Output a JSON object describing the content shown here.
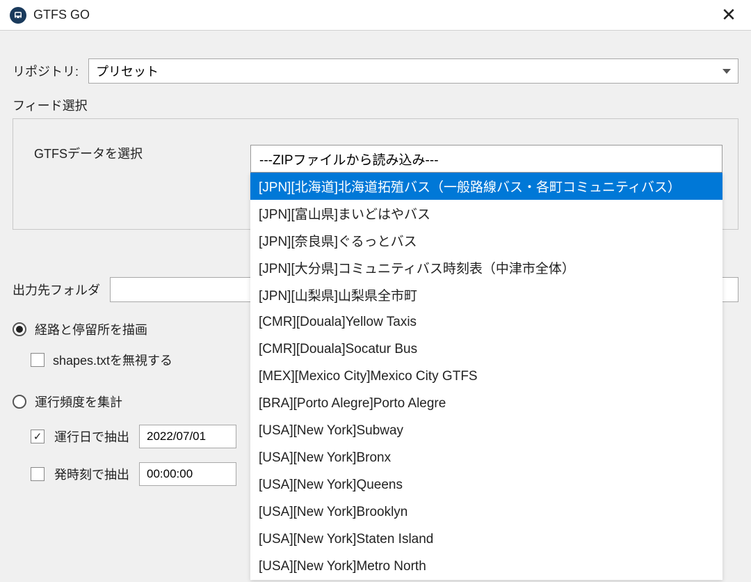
{
  "window": {
    "title": "GTFS GO"
  },
  "repository": {
    "label": "リポジトリ:",
    "value": "プリセット"
  },
  "feed": {
    "section_label": "フィード選択",
    "gtfs_label": "GTFSデータを選択",
    "dropdown_header": "---ZIPファイルから読み込み---",
    "selected_index": 0,
    "items": [
      "[JPN][北海道]北海道拓殖バス（一般路線バス・各町コミュニティバス）",
      "[JPN][富山県]まいどはやバス",
      "[JPN][奈良県]ぐるっとバス",
      "[JPN][大分県]コミュニティバス時刻表（中津市全体）",
      "[JPN][山梨県]山梨県全市町",
      "[CMR][Douala]Yellow Taxis",
      "[CMR][Douala]Socatur Bus",
      "[MEX][Mexico City]Mexico City GTFS",
      "[BRA][Porto Alegre]Porto Alegre",
      "[USA][New York]Subway",
      "[USA][New York]Bronx",
      "[USA][New York]Queens",
      "[USA][New York]Brooklyn",
      "[USA][New York]Staten Island",
      "[USA][New York]Metro North"
    ]
  },
  "output": {
    "label": "出力先フォルダ",
    "value": ""
  },
  "options": {
    "draw_routes_label": "経路と停留所を描画",
    "draw_routes_checked": true,
    "ignore_shapes_label": "shapes.txtを無視する",
    "ignore_shapes_checked": false,
    "aggregate_freq_label": "運行頻度を集計",
    "aggregate_freq_checked": false,
    "filter_by_day_label": "運行日で抽出",
    "filter_by_day_checked": true,
    "filter_day_value": "2022/07/01",
    "filter_by_time_label": "発時刻で抽出",
    "filter_by_time_checked": false,
    "filter_time_value": "00:00:00"
  }
}
